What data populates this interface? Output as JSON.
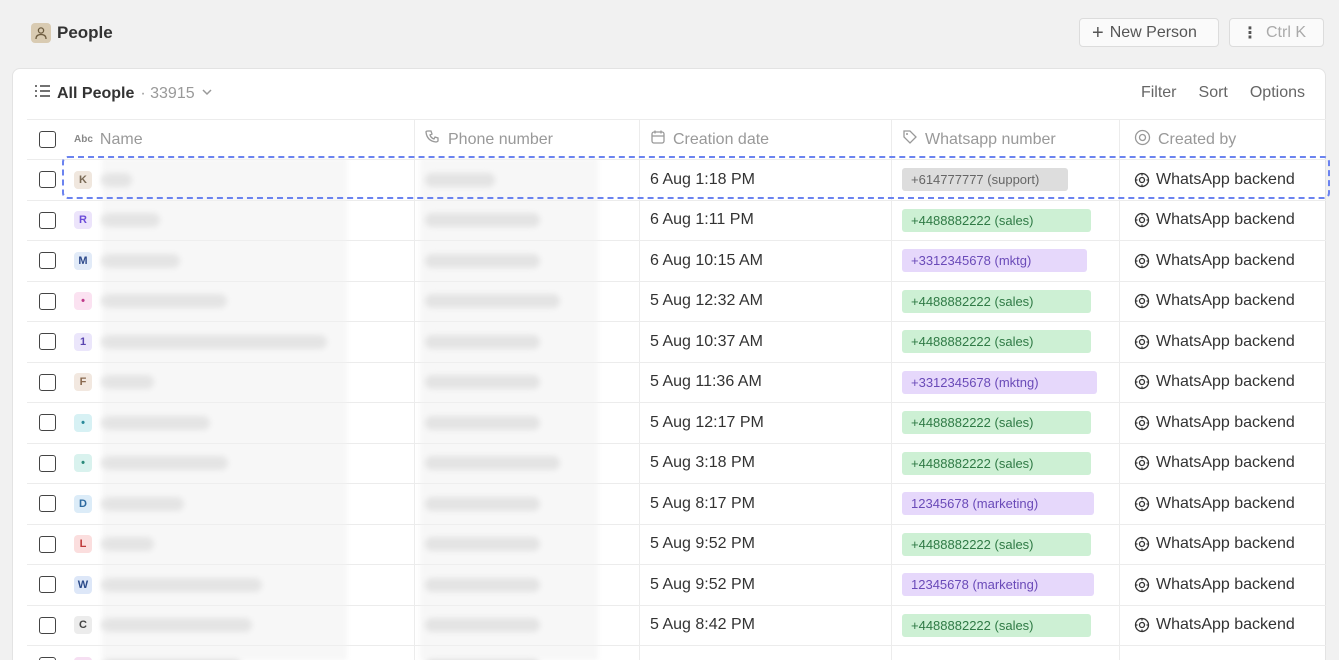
{
  "header": {
    "title": "People",
    "new_person_label": "New Person",
    "shortcut_label": "Ctrl K"
  },
  "view": {
    "name": "All People",
    "count": "· 33915",
    "filter_label": "Filter",
    "sort_label": "Sort",
    "options_label": "Options"
  },
  "columns": {
    "name": "Name",
    "phone": "Phone number",
    "date": "Creation date",
    "whatsapp": "Whatsapp number",
    "created_by": "Created by"
  },
  "rows": [
    {
      "initial": "K",
      "avatar_bg": "#f0e7de",
      "avatar_fg": "#7a6a55",
      "name_w": 30,
      "phone_w": 70,
      "date": "6 Aug 1:18 PM",
      "wa": "+614777777 (support)",
      "wa_bg": "#dddddd",
      "wa_fg": "#666666",
      "wa_w": 166,
      "by": "WhatsApp backend"
    },
    {
      "initial": "R",
      "avatar_bg": "#ece4fb",
      "avatar_fg": "#6b4bd8",
      "name_w": 58,
      "phone_w": 115,
      "date": "6 Aug 1:11 PM",
      "wa": "+4488882222 (sales)",
      "wa_bg": "#cdf0d4",
      "wa_fg": "#2f7a45",
      "wa_w": 189,
      "by": "WhatsApp backend"
    },
    {
      "initial": "M",
      "avatar_bg": "#e2ebf8",
      "avatar_fg": "#2e4a8b",
      "name_w": 78,
      "phone_w": 115,
      "date": "6 Aug 10:15 AM",
      "wa": "+3312345678 (mktg)",
      "wa_bg": "#e6d8fb",
      "wa_fg": "#6a4ab8",
      "wa_w": 185,
      "by": "WhatsApp backend"
    },
    {
      "initial": "•",
      "avatar_bg": "#fbe2f1",
      "avatar_fg": "#c03a8a",
      "name_w": 125,
      "phone_w": 135,
      "date": "5 Aug 12:32 AM",
      "wa": "+4488882222 (sales)",
      "wa_bg": "#cdf0d4",
      "wa_fg": "#2f7a45",
      "wa_w": 189,
      "by": "WhatsApp backend"
    },
    {
      "initial": "1",
      "avatar_bg": "#ebe6fb",
      "avatar_fg": "#5a45b0",
      "name_w": 225,
      "phone_w": 115,
      "date": "5 Aug 10:37 AM",
      "wa": "+4488882222 (sales)",
      "wa_bg": "#cdf0d4",
      "wa_fg": "#2f7a45",
      "wa_w": 189,
      "by": "WhatsApp backend"
    },
    {
      "initial": "F",
      "avatar_bg": "#f2e8e0",
      "avatar_fg": "#8a6a50",
      "name_w": 52,
      "phone_w": 115,
      "date": "5 Aug 11:36 AM",
      "wa": "+3312345678 (mktng)",
      "wa_bg": "#e6d8fb",
      "wa_fg": "#6a4ab8",
      "wa_w": 195,
      "by": "WhatsApp backend"
    },
    {
      "initial": "•",
      "avatar_bg": "#d7f1f4",
      "avatar_fg": "#2a8a9a",
      "name_w": 108,
      "phone_w": 115,
      "date": "5 Aug 12:17 PM",
      "wa": "+4488882222 (sales)",
      "wa_bg": "#cdf0d4",
      "wa_fg": "#2f7a45",
      "wa_w": 189,
      "by": "WhatsApp backend"
    },
    {
      "initial": "•",
      "avatar_bg": "#d9f2ee",
      "avatar_fg": "#2a8a7a",
      "name_w": 126,
      "phone_w": 135,
      "date": "5 Aug 3:18 PM",
      "wa": "+4488882222 (sales)",
      "wa_bg": "#cdf0d4",
      "wa_fg": "#2f7a45",
      "wa_w": 189,
      "by": "WhatsApp backend"
    },
    {
      "initial": "D",
      "avatar_bg": "#dcecf8",
      "avatar_fg": "#2d6aa0",
      "name_w": 82,
      "phone_w": 115,
      "date": "5 Aug 8:17 PM",
      "wa": "12345678 (marketing)",
      "wa_bg": "#e6d8fb",
      "wa_fg": "#6a4ab8",
      "wa_w": 192,
      "by": "WhatsApp backend"
    },
    {
      "initial": "L",
      "avatar_bg": "#fbdede",
      "avatar_fg": "#c03a3a",
      "name_w": 52,
      "phone_w": 115,
      "date": "5 Aug 9:52 PM",
      "wa": "+4488882222 (sales)",
      "wa_bg": "#cdf0d4",
      "wa_fg": "#2f7a45",
      "wa_w": 189,
      "by": "WhatsApp backend"
    },
    {
      "initial": "W",
      "avatar_bg": "#dde7f8",
      "avatar_fg": "#2a4a8a",
      "name_w": 160,
      "phone_w": 115,
      "date": "5 Aug 9:52 PM",
      "wa": "12345678 (marketing)",
      "wa_bg": "#e6d8fb",
      "wa_fg": "#6a4ab8",
      "wa_w": 192,
      "by": "WhatsApp backend"
    },
    {
      "initial": "C",
      "avatar_bg": "#ececec",
      "avatar_fg": "#444444",
      "name_w": 150,
      "phone_w": 115,
      "date": "5 Aug 8:42 PM",
      "wa": "+4488882222 (sales)",
      "wa_bg": "#cdf0d4",
      "wa_fg": "#2f7a45",
      "wa_w": 189,
      "by": "WhatsApp backend"
    },
    {
      "initial": "•",
      "avatar_bg": "#f6dff2",
      "avatar_fg": "#b04aa0",
      "name_w": 140,
      "phone_w": 115,
      "date": "",
      "wa": "",
      "wa_bg": "#cdf0d4",
      "wa_fg": "#2f7a45",
      "wa_w": 0,
      "by": ""
    }
  ]
}
